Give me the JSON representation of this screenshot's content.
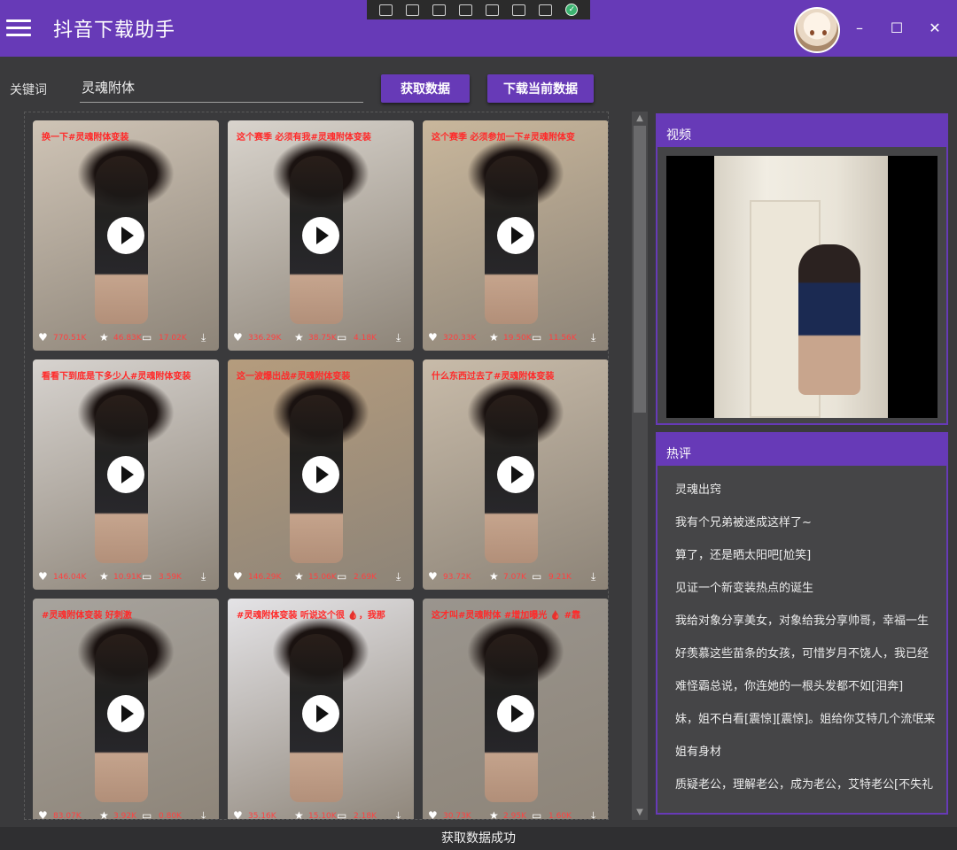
{
  "app": {
    "title": "抖音下载助手"
  },
  "search": {
    "label": "关键词",
    "value": "灵魂附体"
  },
  "buttons": {
    "fetch": "获取数据",
    "download_current": "下载当前数据"
  },
  "videos": [
    {
      "caption": "换一下#灵魂附体变装",
      "likes": "770.51K",
      "stars": "46.83K",
      "comments": "17.02K",
      "bg": "#cfc4b6"
    },
    {
      "caption": "这个赛季 必须有我#灵魂附体变装",
      "likes": "336.29K",
      "stars": "38.75K",
      "comments": "4.18K",
      "bg": "#d9d4cd"
    },
    {
      "caption": "这个赛季 必须参加一下#灵魂附体变",
      "likes": "320.33K",
      "stars": "19.50K",
      "comments": "11.56K",
      "bg": "#c9b79c"
    },
    {
      "caption": "看看下到底是下多少人#灵魂附体变装",
      "likes": "146.04K",
      "stars": "10.91K",
      "comments": "3.59K",
      "bg": "#d7d3cf"
    },
    {
      "caption": "这一波爆出战#灵魂附体变装",
      "likes": "146.29K",
      "stars": "15.06K",
      "comments": "2.69K",
      "bg": "#b59c7d"
    },
    {
      "caption": "什么东西过去了#灵魂附体变装",
      "likes": "93.72K",
      "stars": "7.07K",
      "comments": "9.21K",
      "bg": "#c8bba9"
    },
    {
      "caption": "#灵魂附体变装    好刺激",
      "likes": "83.07K",
      "stars": "3.92K",
      "comments": "0.80K",
      "bg": "#a7a39d"
    },
    {
      "caption": "#灵魂附体变装  听说这个很 🩸，我那",
      "likes": "35.16K",
      "stars": "15.10K",
      "comments": "2.18K",
      "bg": "#e4e3e6"
    },
    {
      "caption": "这才叫#灵魂附体 #增加曝光 🩸 #靠",
      "likes": "30.73K",
      "stars": "2.95K",
      "comments": "1.60K",
      "bg": "#9a958e"
    }
  ],
  "right_panel": {
    "video_title": "视频",
    "comments_title": "热评",
    "comments": [
      "灵魂出窍",
      "我有个兄弟被迷成这样了~",
      "算了，还是晒太阳吧[尬笑]",
      "见证一个新变装热点的诞生",
      "我给对象分享美女，对象给我分享帅哥，幸福一生",
      "好羡慕这些苗条的女孩，可惜岁月不饶人，我已经",
      "难怪霸总说，你连她的一根头发都不如[泪奔]",
      "妹，姐不白看[震惊][震惊]。姐给你艾特几个流氓来",
      "姐有身材",
      "质疑老公，理解老公，成为老公，艾特老公[不失礼"
    ]
  },
  "status": {
    "message": "获取数据成功"
  },
  "colors": {
    "primary": "#673ab7",
    "background": "#3a3a3c",
    "accent_red": "#ff2a2a"
  }
}
